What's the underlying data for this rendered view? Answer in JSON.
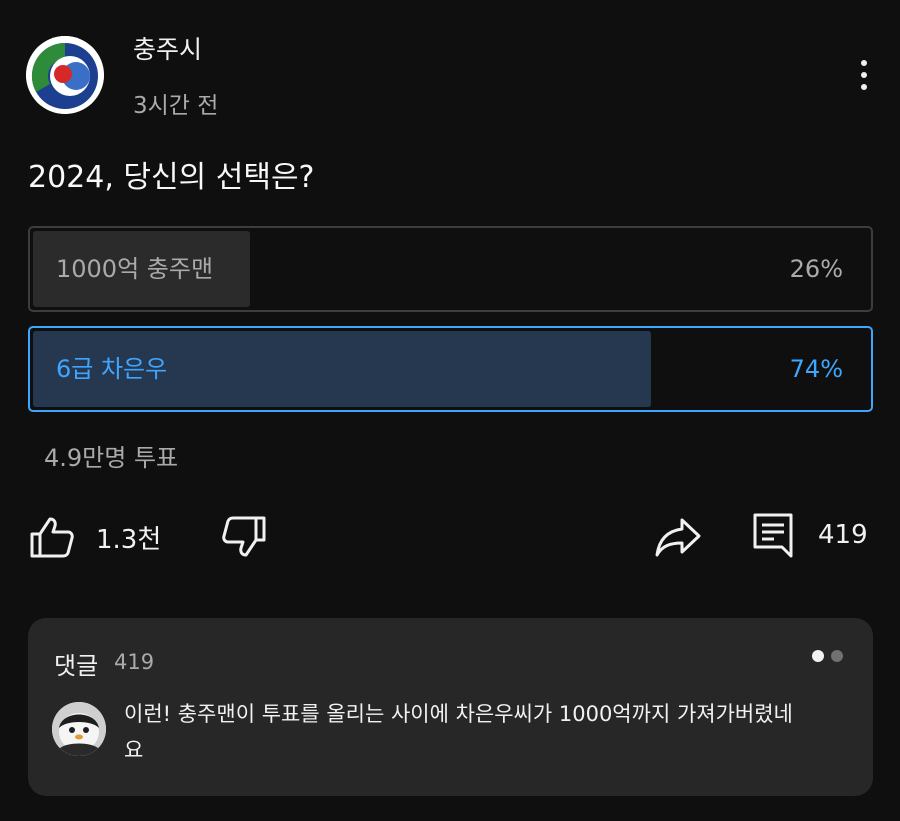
{
  "post": {
    "channel_name": "충주시",
    "time": "3시간 전",
    "text": "2024, 당신의 선택은?"
  },
  "poll": {
    "options": [
      {
        "label": "1000억 충주맨",
        "percent_text": "26%",
        "fraction": 0.26
      },
      {
        "label": "6급 차은우",
        "percent_text": "74%",
        "fraction": 0.74
      }
    ],
    "votes": "4.9만명 투표",
    "accent_color": "#3ea6ff"
  },
  "actions": {
    "like_count": "1.3천",
    "comment_count": "419"
  },
  "comments": {
    "title": "댓글",
    "count": "419",
    "top_comment": "이런! 충주맨이 투표를 올리는 사이에 차은우씨가 1000억까지 가져가버렸네요"
  }
}
